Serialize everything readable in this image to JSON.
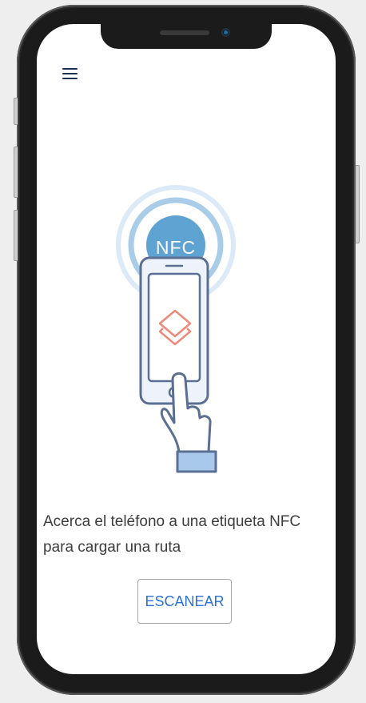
{
  "device": {
    "frame_color": "#1b1b1b",
    "screen_color": "#ffffff",
    "background_color": "#eeeeee"
  },
  "header": {
    "menu_icon": "hamburger-menu-icon",
    "icon_color": "#1f2d4d"
  },
  "illustration": {
    "badge_text": "NFC",
    "icon": "nfc-phone-tap-illustration"
  },
  "main": {
    "message": "Acerca el teléfono a una etiqueta NFC\npara cargar una ruta",
    "scan_button_label": "ESCANEAR",
    "accent_color": "#2a72d6"
  }
}
